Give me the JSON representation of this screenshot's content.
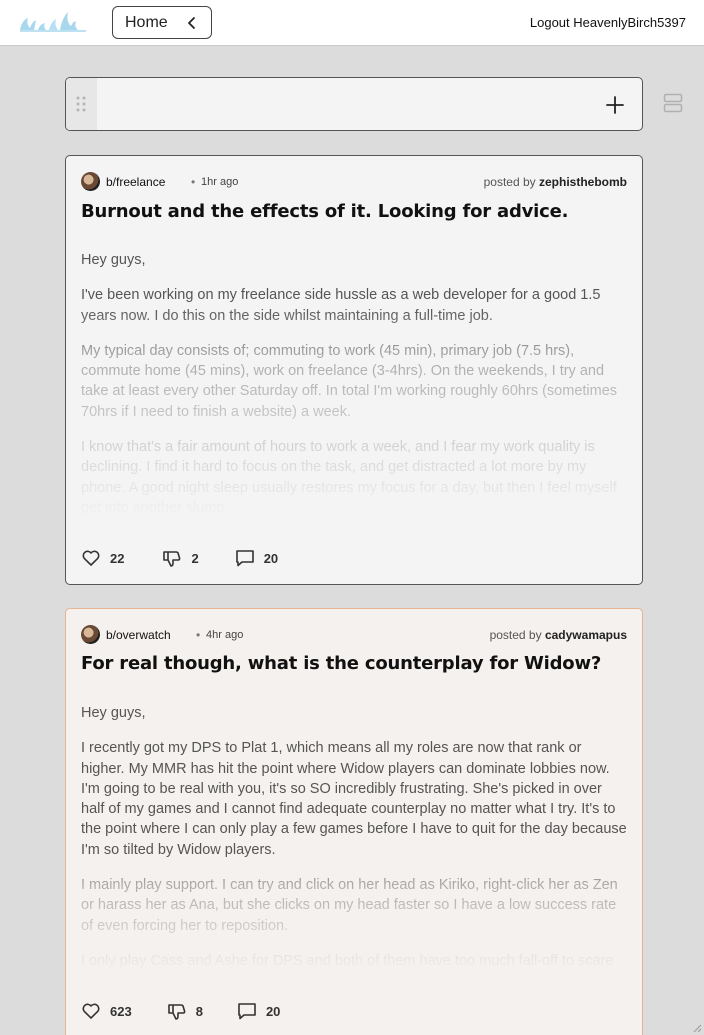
{
  "nav": {
    "home_label": "Home",
    "logout_label": "Logout",
    "username": "HeavenlyBirch5397"
  },
  "posts": [
    {
      "board": "b/freelance",
      "time": "1hr ago",
      "posted_by_label": "posted by",
      "author": "zephisthebomb",
      "title": "Burnout and the effects of it. Looking for advice.",
      "paragraphs": [
        "Hey guys,",
        "I've been working on my freelance side hussle as a web developer for a good 1.5 years now. I do this on the side whilst maintaining a full-time job.",
        "My typical day consists of; commuting to work (45 min), primary job (7.5 hrs), commute home (45 mins), work on freelance (3-4hrs). On the weekends, I try and take at least every other Saturday off. In total I'm working roughly 60hrs (sometimes 70hrs if I need to finish a website) a week.",
        "I know that's a fair amount of hours to work a week, and I fear my work quality is declining. I find it hard to focus on the task, and get distracted a lot more by my phone. A good night sleep usually restores my focus for a day, but then I feel myself get into another slump."
      ],
      "likes": "22",
      "dislikes": "2",
      "comments": "20"
    },
    {
      "board": "b/overwatch",
      "time": "4hr ago",
      "posted_by_label": "posted by",
      "author": "cadywamapus",
      "title": "For real though, what is the counterplay for Widow?",
      "paragraphs": [
        "Hey guys,",
        "I recently got my DPS to Plat 1, which means all my roles are now that rank or higher. My MMR has hit the point where Widow players can dominate lobbies now. I'm going to be real with you, it's so SO incredibly frustrating. She's picked in over half of my games and I cannot find adequate counterplay no matter what I try. It's to the point where I can only play a few games before I have to quit for the day because I'm so tilted by Widow players.",
        "I mainly play support. I can try and click on her head as Kiriko, right-click her as Zen or harass her as Ana, but she clicks on my head faster so I have a low success rate of even forcing her to reposition.",
        "I only play Cass and Ashe for DPS and both of them have too much fall-off to scare"
      ],
      "likes": "623",
      "dislikes": "8",
      "comments": "20"
    }
  ],
  "icons": {
    "logo": "site-logo",
    "home_chevron": "chevron-left-icon",
    "drag": "drag-handle-icon",
    "add": "plus-icon",
    "layout": "layout-toggle-icon",
    "like": "heart-icon",
    "dislike": "thumbs-down-icon",
    "comment": "comment-icon"
  },
  "colors": {
    "background": "#dcdcdc",
    "card": "#f4f4f4",
    "card_highlight": "#f5f1ee",
    "highlight_border": "#e8b48f",
    "logo": "#a9d8ee"
  }
}
